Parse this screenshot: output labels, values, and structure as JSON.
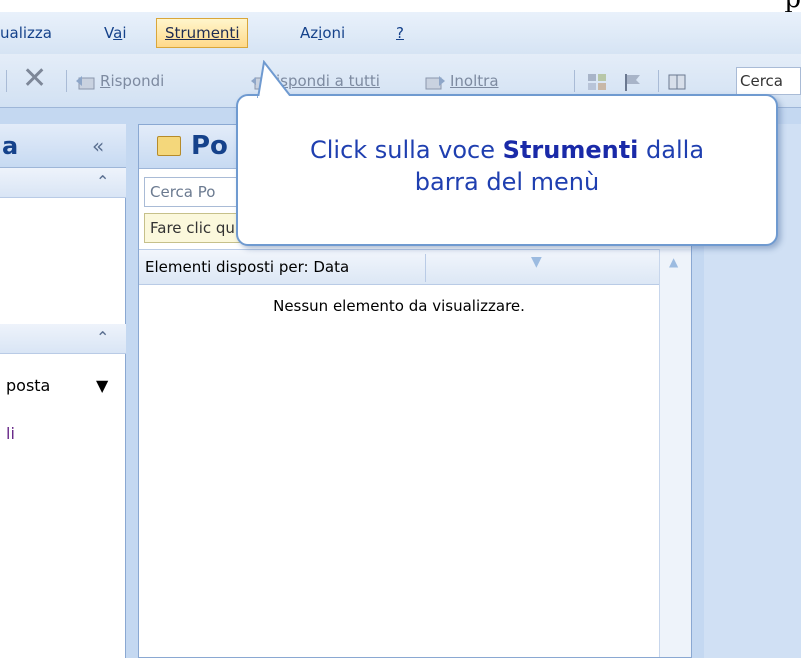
{
  "page_glyph": "p",
  "menubar": {
    "items": [
      {
        "pre": "ualizza",
        "ul": "",
        "post": ""
      },
      {
        "pre": "V",
        "ul": "a",
        "post": "i"
      },
      {
        "pre": "",
        "ul": "S",
        "post": "trumenti"
      },
      {
        "pre": "Az",
        "ul": "i",
        "post": "oni"
      },
      {
        "pre": "",
        "ul": "?",
        "post": ""
      }
    ],
    "active_index": 2
  },
  "toolbar": {
    "rispondi_ul": "R",
    "rispondi_rest": "ispondi",
    "rispondi_tutti": "ispondi a tutti",
    "inoltra": "Inoltra",
    "cerca": "Cerca"
  },
  "nav": {
    "title": "a",
    "collapse": "«",
    "folder": "posta",
    "link": "li"
  },
  "list": {
    "title": "Po",
    "search_value": "Cerca Po",
    "instant_search": "Fare clic qui per attivare Ricerca immediata",
    "arrange_by": "Elementi disposti per: Data",
    "empty_message": "Nessun elemento da visualizzare."
  },
  "callout": {
    "text_pre": "Click sulla voce ",
    "text_bold": "Strumenti",
    "text_post": " dalla",
    "line2": "barra del menù"
  },
  "colors": {
    "accent": "#15428b",
    "callout_text": "#1f3fb0",
    "callout_border": "#6f9ad0",
    "menu_active": "#ffd98a"
  }
}
